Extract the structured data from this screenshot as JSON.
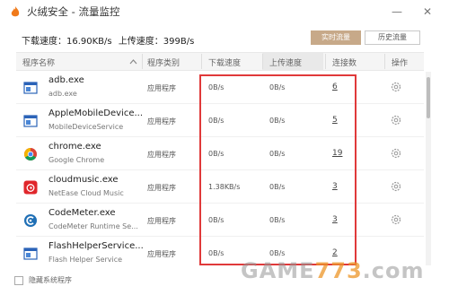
{
  "window": {
    "title": "火绒安全 - 流量监控",
    "minimize_glyph": "—",
    "close_glyph": "✕",
    "logo_icon": "huorong-flame-icon"
  },
  "summary": {
    "download": "下载速度：16.90KB/s",
    "upload": "上传速度：399B/s"
  },
  "tabs": {
    "realtime": "实时流量",
    "history": "历史流量"
  },
  "table": {
    "headers": {
      "name": "程序名称",
      "type": "程序类别",
      "download": "下载速度",
      "upload": "上传速度",
      "connections": "连接数",
      "actions": "操作"
    },
    "sort_icon": "chevron-up-icon",
    "rows": [
      {
        "name": "adb.exe",
        "desc": "adb.exe",
        "type": "应用程序",
        "down": "0B/s",
        "up": "0B/s",
        "conn": "6",
        "icon": "window-icon",
        "has_gear": true
      },
      {
        "name": "AppleMobileDevice...",
        "desc": "MobileDeviceService",
        "type": "应用程序",
        "down": "0B/s",
        "up": "0B/s",
        "conn": "5",
        "icon": "window-icon",
        "has_gear": true
      },
      {
        "name": "chrome.exe",
        "desc": "Google Chrome",
        "type": "应用程序",
        "down": "0B/s",
        "up": "0B/s",
        "conn": "19",
        "icon": "chrome-icon",
        "has_gear": true
      },
      {
        "name": "cloudmusic.exe",
        "desc": "NetEase Cloud Music",
        "type": "应用程序",
        "down": "1.38KB/s",
        "up": "0B/s",
        "conn": "3",
        "icon": "netease-music-icon",
        "has_gear": true
      },
      {
        "name": "CodeMeter.exe",
        "desc": "CodeMeter Runtime Se...",
        "type": "应用程序",
        "down": "0B/s",
        "up": "0B/s",
        "conn": "3",
        "icon": "codemeter-icon",
        "has_gear": true
      },
      {
        "name": "FlashHelperService...",
        "desc": "Flash Helper Service",
        "type": "应用程序",
        "down": "0B/s",
        "up": "0B/s",
        "conn": "2",
        "icon": "window-icon",
        "has_gear": false
      }
    ]
  },
  "footer": {
    "hide_system_label": "隐藏系统程序",
    "hide_system_checked": false
  },
  "watermark": {
    "left": "GAME",
    "mid": "773",
    "right": ".com"
  },
  "colors": {
    "tab_active_bg": "#c7a989",
    "highlight_border": "#e0393a"
  }
}
